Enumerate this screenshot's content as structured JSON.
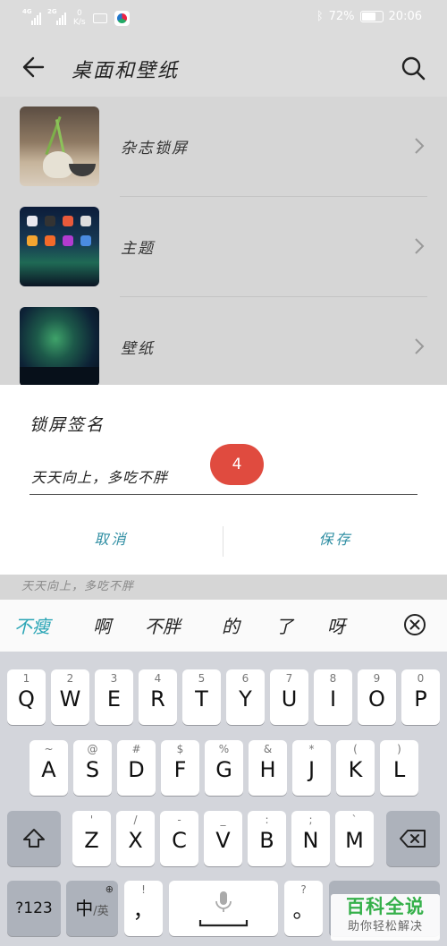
{
  "status_bar": {
    "sim1_tag": "4G",
    "sim2_tag": "2G",
    "net_speed_value": "0",
    "net_speed_unit": "K/s",
    "battery_text": "72%",
    "battery_level": 0.72,
    "time": "20:06"
  },
  "app_bar": {
    "title": "桌面和壁纸",
    "back_icon": "arrow-left-icon",
    "search_icon": "search-icon"
  },
  "list": {
    "items": [
      {
        "label": "杂志锁屏"
      },
      {
        "label": "主题"
      },
      {
        "label": "壁纸"
      }
    ]
  },
  "dialog": {
    "title": "锁屏签名",
    "input_value": "天天向上，多吃不胖",
    "char_count_badge": "4",
    "cancel_label": "取消",
    "save_label": "保存"
  },
  "peek_row": {
    "text": "天天向上，多吃不胖"
  },
  "candidates": {
    "items": [
      "不瘦",
      "啊",
      "不胖",
      "的",
      "了",
      "呀"
    ],
    "active_index": 0,
    "accent_color": "#2aa5b5"
  },
  "keyboard": {
    "row1": [
      {
        "main": "Q",
        "sub": "1"
      },
      {
        "main": "W",
        "sub": "2"
      },
      {
        "main": "E",
        "sub": "3"
      },
      {
        "main": "R",
        "sub": "4"
      },
      {
        "main": "T",
        "sub": "5"
      },
      {
        "main": "Y",
        "sub": "6"
      },
      {
        "main": "U",
        "sub": "7"
      },
      {
        "main": "I",
        "sub": "8"
      },
      {
        "main": "O",
        "sub": "9"
      },
      {
        "main": "P",
        "sub": "0"
      }
    ],
    "row2": [
      {
        "main": "A",
        "sub": "~"
      },
      {
        "main": "S",
        "sub": "@"
      },
      {
        "main": "D",
        "sub": "#"
      },
      {
        "main": "F",
        "sub": "$"
      },
      {
        "main": "G",
        "sub": "%"
      },
      {
        "main": "H",
        "sub": "&"
      },
      {
        "main": "J",
        "sub": "*"
      },
      {
        "main": "K",
        "sub": "("
      },
      {
        "main": "L",
        "sub": ")"
      }
    ],
    "row3": [
      {
        "main": "Z",
        "sub": "'"
      },
      {
        "main": "X",
        "sub": "/"
      },
      {
        "main": "C",
        "sub": "-"
      },
      {
        "main": "V",
        "sub": "_"
      },
      {
        "main": "B",
        "sub": ":"
      },
      {
        "main": "N",
        "sub": ";"
      },
      {
        "main": "M",
        "sub": "`"
      }
    ],
    "symbols_label": "?123",
    "lang_main": "中",
    "lang_sub": "/英",
    "comma_label": "，",
    "comma_sub": "!",
    "period_label": "。",
    "period_sub": "?"
  },
  "watermark": {
    "line1": "百科全说",
    "line2": "助你轻松解决"
  }
}
